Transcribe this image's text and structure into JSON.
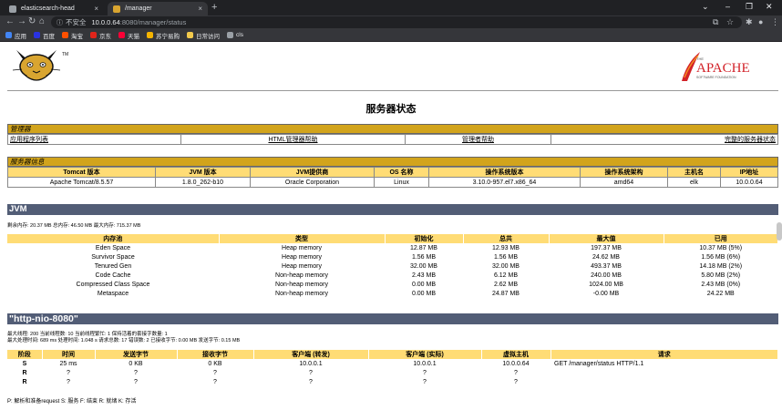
{
  "browser": {
    "tabs": [
      {
        "title": "elasticsearch-head",
        "close": "×"
      },
      {
        "title": "/manager",
        "close": "×"
      }
    ],
    "new_tab": "+",
    "window_controls": {
      "minimize": "–",
      "restore": "❐",
      "close": "✕",
      "tabs_menu": "⌄"
    },
    "nav": {
      "back": "←",
      "forward": "→",
      "reload": "↻",
      "home": "⌂"
    },
    "address": {
      "security_label": "不安全",
      "host": "10.0.0.64",
      "path": ":8080/manager/status"
    },
    "toolbar_icons": {
      "translate": "⧉",
      "star": "☆",
      "extensions": "✱",
      "profile": "●",
      "menu": "⋮"
    },
    "bookmarks": [
      {
        "label": "应用",
        "color": "#4285f4"
      },
      {
        "label": "百度",
        "color": "#2932e1"
      },
      {
        "label": "淘宝",
        "color": "#ff5000"
      },
      {
        "label": "京东",
        "color": "#e1251b"
      },
      {
        "label": "天猫",
        "color": "#ff0036"
      },
      {
        "label": "苏宁易购",
        "color": "#f5b400"
      },
      {
        "label": "日常访问",
        "color": "#f2c94c"
      },
      {
        "label": "cls",
        "color": "#9aa0a6"
      }
    ]
  },
  "page": {
    "title": "服务器状态",
    "apache_logo_text": "APACHE",
    "apache_logo_sub": "SOFTWARE FOUNDATION",
    "apache_logo_the": "THE",
    "tomcat_logo_tm": "TM",
    "manager": {
      "heading": "管理器",
      "links": [
        "应用程序列表",
        "HTML管理器帮助",
        "管理者帮助",
        "完整的服务器状态"
      ]
    },
    "server_info": {
      "heading": "服务器信息",
      "headers": [
        "Tomcat 版本",
        "JVM 版本",
        "JVM提供商",
        "OS 名称",
        "操作系统版本",
        "操作系统架构",
        "主机名",
        "IP地址"
      ],
      "values": [
        "Apache Tomcat/8.5.57",
        "1.8.0_262-b10",
        "Oracle Corporation",
        "Linux",
        "3.10.0-957.el7.x86_64",
        "amd64",
        "elk",
        "10.0.0.64"
      ]
    },
    "jvm": {
      "heading": "JVM",
      "summary": "剩余内存: 20.37 MB 总内存: 46.50 MB 最大内存: 715.37 MB",
      "headers": [
        "内存池",
        "类型",
        "初始化",
        "总共",
        "最大值",
        "已用"
      ],
      "rows": [
        [
          "Eden Space",
          "Heap memory",
          "12.87 MB",
          "12.93 MB",
          "197.37 MB",
          "10.37 MB (5%)"
        ],
        [
          "Survivor Space",
          "Heap memory",
          "1.56 MB",
          "1.56 MB",
          "24.62 MB",
          "1.56 MB (6%)"
        ],
        [
          "Tenured Gen",
          "Heap memory",
          "32.00 MB",
          "32.00 MB",
          "493.37 MB",
          "14.18 MB (2%)"
        ],
        [
          "Code Cache",
          "Non-heap memory",
          "2.43 MB",
          "6.12 MB",
          "240.00 MB",
          "5.80 MB (2%)"
        ],
        [
          "Compressed Class Space",
          "Non-heap memory",
          "0.00 MB",
          "2.62 MB",
          "1024.00 MB",
          "2.43 MB (0%)"
        ],
        [
          "Metaspace",
          "Non-heap memory",
          "0.00 MB",
          "24.87 MB",
          "-0.00 MB",
          "24.22 MB"
        ]
      ]
    },
    "connector": {
      "heading": "\"http-nio-8080\"",
      "line1": "最大线程: 200 当前线程数: 10 当前线程繁忙: 1 保持活着的套接字数量: 1",
      "line2": "最大处理时间: 689 ms 处理时间: 1.048 s 请求总数: 17 错误数: 2 已接收字节: 0.00 MB 发送字节: 0.15 MB",
      "headers": [
        "阶段",
        "时间",
        "发送字节",
        "接收字节",
        "客户端 (转发)",
        "客户端 (实际)",
        "虚拟主机",
        "请求"
      ],
      "rows": [
        [
          "S",
          "25 ms",
          "0 KB",
          "0 KB",
          "10.0.0.1",
          "10.0.0.1",
          "10.0.0.64",
          "GET /manager/status HTTP/1.1"
        ],
        [
          "R",
          "?",
          "?",
          "?",
          "?",
          "?",
          "?",
          ""
        ],
        [
          "R",
          "?",
          "?",
          "?",
          "?",
          "?",
          "?",
          ""
        ]
      ],
      "legend": "P: 解析和准备request S: 服务 F: 结束 R: 就绪 K: 存活"
    }
  }
}
